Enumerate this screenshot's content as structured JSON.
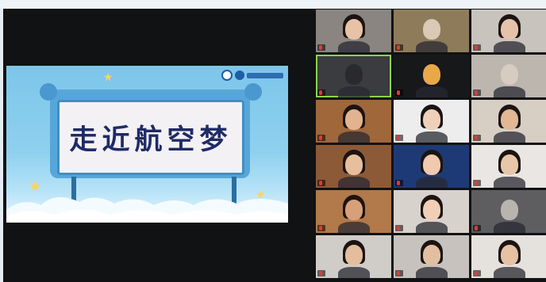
{
  "slide": {
    "title": "走近航空梦",
    "logo_icon": "organization-logo",
    "colors": {
      "sky": "#8fd0ef",
      "board": "#f4f1f4",
      "title": "#1f2b66"
    }
  },
  "gallery": {
    "tiles": [
      {
        "id": "p1",
        "name": "",
        "face": "#e8c2a6",
        "hair": true,
        "bg": "#8a8580"
      },
      {
        "id": "p2",
        "name": "",
        "face": "#d9c9b5",
        "hair": false,
        "bg": "#8e7b5a"
      },
      {
        "id": "p3",
        "name": "",
        "face": "#e6c3a8",
        "hair": true,
        "bg": "#c9c3bd"
      },
      {
        "id": "p4",
        "name": "",
        "face": "#2a2a2c",
        "hair": false,
        "bg": "#3a3c40"
      },
      {
        "id": "p5",
        "name": "",
        "face": "#e8a84a",
        "hair": false,
        "bg": "#17181a"
      },
      {
        "id": "p6",
        "name": "",
        "face": "#d8cbbf",
        "hair": false,
        "bg": "#bcb6af"
      },
      {
        "id": "p7",
        "name": "",
        "face": "#e3b38f",
        "hair": true,
        "bg": "#a0673a"
      },
      {
        "id": "p8",
        "name": "",
        "face": "#efd0bb",
        "hair": true,
        "bg": "#ededed"
      },
      {
        "id": "p9",
        "name": "",
        "face": "#e1b794",
        "hair": true,
        "bg": "#d7cfc4"
      },
      {
        "id": "p10",
        "name": "",
        "face": "#e7bf9c",
        "hair": true,
        "bg": "#8c5a36"
      },
      {
        "id": "p11",
        "name": "",
        "face": "#f0c9b0",
        "hair": true,
        "bg": "#1e3a76"
      },
      {
        "id": "p12",
        "name": "",
        "face": "#e8c6a9",
        "hair": true,
        "bg": "#e9e6e3"
      },
      {
        "id": "p13",
        "name": "",
        "face": "#d8a07a",
        "hair": true,
        "bg": "#b2794a"
      },
      {
        "id": "p14",
        "name": "",
        "face": "#f1cfb6",
        "hair": true,
        "bg": "#d8d2cc"
      },
      {
        "id": "p15",
        "name": "",
        "face": "#b9b4b0",
        "hair": false,
        "bg": "#5e5e60"
      },
      {
        "id": "p16",
        "name": "",
        "face": "#e4bd9c",
        "hair": true,
        "bg": "#d0ccc7"
      },
      {
        "id": "p17",
        "name": "",
        "face": "#e3bfa2",
        "hair": true,
        "bg": "#c7c2bd"
      },
      {
        "id": "p18",
        "name": "",
        "face": "#e6c1a3",
        "hair": true,
        "bg": "#e5e1dc"
      }
    ]
  }
}
